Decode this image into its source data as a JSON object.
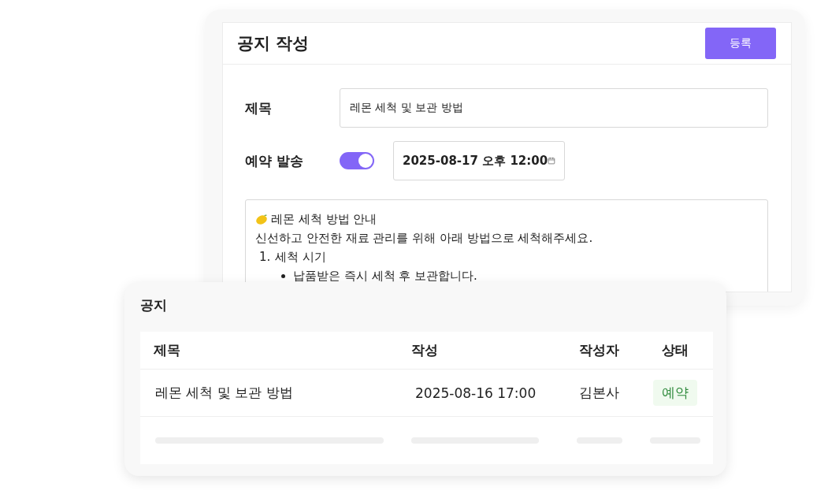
{
  "editor_card": {
    "title": "공지 작성",
    "submit_button": "등록",
    "fields": [
      {
        "kind": "text",
        "label": "제목",
        "value": "레몬 세척 및 보관 방법"
      },
      {
        "kind": "schedule",
        "label": "예약 발송",
        "on": true,
        "value": "2025-08-17 오후 12:00"
      }
    ],
    "content": [
      {
        "kind": "heading",
        "text": "레몬 세척 방법 안내"
      },
      {
        "kind": "paragraph",
        "text": "신선하고 안전한 재료 관리를 위해 아래 방법으로 세척해주세요."
      },
      {
        "kind": "numbered",
        "marker": "1.",
        "text": "세척 시기"
      },
      {
        "kind": "bullet",
        "text": "납품받은 즉시 세척 후 보관합니다."
      }
    ]
  },
  "list_card": {
    "title": "공지",
    "columns": [
      "제목",
      "작성",
      "작성자",
      "상태"
    ],
    "rows": [
      {
        "title": "레몬 세척 및 보관 방법",
        "date": "2025-08-16 17:00",
        "author": "김본사",
        "status": "예약"
      }
    ]
  }
}
